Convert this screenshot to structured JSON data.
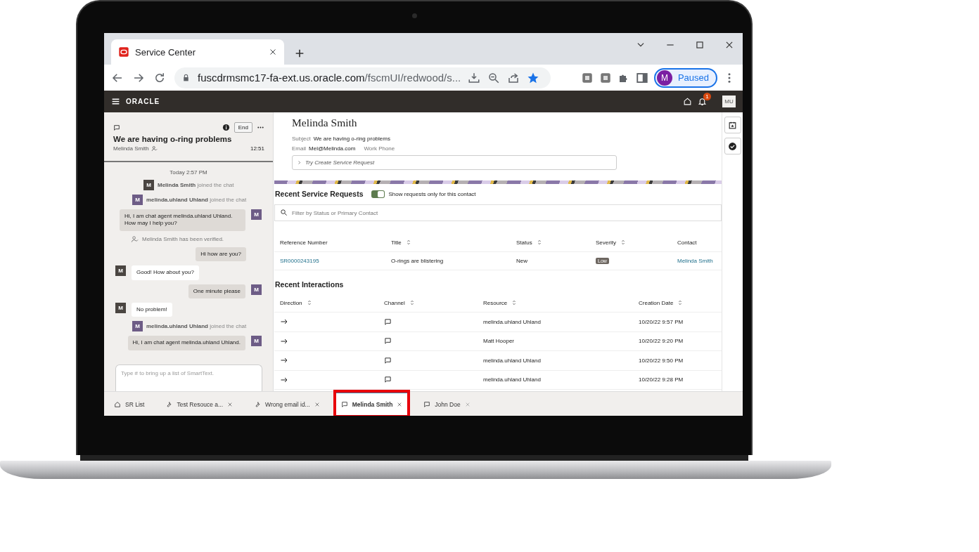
{
  "browser": {
    "tab_title": "Service Center",
    "url_host": "fuscdrmsmc17-fa-ext.us.oracle.com",
    "url_path": "/fscmUI/redwood/s...",
    "bookmarked": true,
    "profile_initial": "M",
    "profile_status": "Paused"
  },
  "app_header": {
    "logo": "ORACLE",
    "notification_count": "1",
    "user_initials": "MU"
  },
  "chat": {
    "title": "We are having o-ring problems",
    "end_button": "End",
    "contact": "Melinda Smith",
    "time": "12:51",
    "messages": [
      {
        "kind": "timestamp",
        "text": "Today 2:57 PM"
      },
      {
        "kind": "customer_event",
        "avatar": "M",
        "name": "Melinda Smith",
        "text": "joined the chat"
      },
      {
        "kind": "agent_event",
        "avatar": "M",
        "name": "melinda.uhland Uhland",
        "text": "joined the chat"
      },
      {
        "kind": "agent_message",
        "avatar": "M",
        "text": "Hi, I am chat agent melinda.uhland Uhland. How may I help you?"
      },
      {
        "kind": "notice",
        "text": "Melinda Smith has been verified."
      },
      {
        "kind": "agent_message",
        "text": "Hi how are you?"
      },
      {
        "kind": "customer_message",
        "avatar": "M",
        "text": "Good! How about you?"
      },
      {
        "kind": "agent_message",
        "avatar": "M",
        "text": "One minute please"
      },
      {
        "kind": "customer_message",
        "avatar": "M",
        "text": "No problem!"
      },
      {
        "kind": "agent_event",
        "avatar": "M",
        "name": "melinda.uhland Uhland",
        "text": "joined the chat"
      },
      {
        "kind": "agent_message",
        "avatar": "M",
        "text": "Hi, I am chat agent melinda.uhland Uhland."
      }
    ],
    "composer": {
      "placeholder": "Type # to bring up a list of SmartText."
    }
  },
  "contact": {
    "name": "Melinda Smith",
    "subject_label": "Subject",
    "subject": "We are having o-ring problems",
    "email_label": "Email",
    "email": "Mel@Melinda.com",
    "phone_label": "Work Phone",
    "suggestion": "Try Create Service Request"
  },
  "service_requests": {
    "title": "Recent Service Requests",
    "toggle": {
      "label": "Show requests only for this contact",
      "on": true
    },
    "filter": {
      "placeholder": "Filter by Status or Primary Contact"
    },
    "columns": [
      {
        "label": "Reference Number",
        "sortable": false
      },
      {
        "label": "Title",
        "sortable": true
      },
      {
        "label": "Status",
        "sortable": true
      },
      {
        "label": "Severity",
        "sortable": true
      },
      {
        "label": "Contact",
        "sortable": false
      }
    ],
    "rows": [
      {
        "reference": "SR0000243195",
        "title": "O-rings are blistering",
        "status": "New",
        "severity": "Low",
        "contact": "Melinda Smith"
      }
    ]
  },
  "interactions": {
    "title": "Recent Interactions",
    "columns": [
      {
        "label": "Direction",
        "sortable": true
      },
      {
        "label": "Channel",
        "sortable": true
      },
      {
        "label": "Resource",
        "sortable": true
      },
      {
        "label": "Creation Date",
        "sortable": true
      }
    ],
    "rows": [
      {
        "resource": "melinda.uhland Uhland",
        "created": "10/20/22 9:57 PM"
      },
      {
        "resource": "Matt Hooper",
        "created": "10/20/22 9:20 PM"
      },
      {
        "resource": "melinda.uhland Uhland",
        "created": "10/20/22 9:50 PM"
      },
      {
        "resource": "melinda.uhland Uhland",
        "created": "10/20/22 9:28 PM"
      }
    ]
  },
  "work_tabs": [
    {
      "kind": "home",
      "label": "SR List",
      "selected": false,
      "closable": false,
      "highlighted": false
    },
    {
      "kind": "tool",
      "label": "Test Resouce a...",
      "selected": false,
      "closable": true,
      "highlighted": false
    },
    {
      "kind": "tool",
      "label": "Wrong email id...",
      "selected": false,
      "closable": true,
      "highlighted": false
    },
    {
      "kind": "chat",
      "label": "Melinda Smith",
      "selected": true,
      "closable": true,
      "highlighted": true
    },
    {
      "kind": "chat",
      "label": "John Doe",
      "selected": false,
      "closable": true,
      "highlighted": false
    }
  ]
}
